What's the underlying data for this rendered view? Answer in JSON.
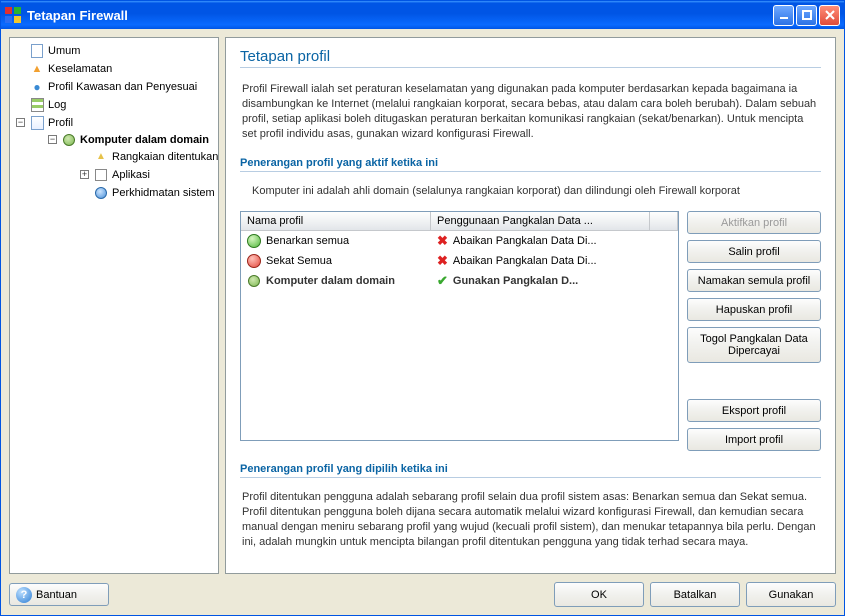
{
  "window": {
    "title": "Tetapan Firewall"
  },
  "sidebar": {
    "items": [
      {
        "label": "Umum"
      },
      {
        "label": "Keselamatan"
      },
      {
        "label": "Profil Kawasan dan Penyesuai"
      },
      {
        "label": "Log"
      },
      {
        "label": "Profil",
        "children": [
          {
            "label": "Komputer dalam domain",
            "selected": true,
            "children": [
              {
                "label": "Rangkaian ditentukan"
              },
              {
                "label": "Aplikasi",
                "expandable": true
              },
              {
                "label": "Perkhidmatan sistem"
              }
            ]
          }
        ]
      }
    ]
  },
  "main": {
    "title": "Tetapan profil",
    "intro": "Profil Firewall ialah set peraturan keselamatan yang digunakan pada komputer berdasarkan kepada bagaimana ia disambungkan ke Internet (melalui rangkaian korporat, secara bebas, atau dalam cara boleh berubah). Dalam sebuah profil, setiap aplikasi boleh ditugaskan peraturan berkaitan komunikasi rangkaian (sekat/benarkan). Untuk mencipta set profil individu asas, gunakan wizard konfigurasi Firewall.",
    "activeHeading": "Penerangan profil yang aktif ketika ini",
    "activeDesc": "Komputer ini adalah ahli domain (selalunya rangkaian korporat) dan dilindungi oleh  Firewall korporat",
    "selectedHeading": "Penerangan profil yang dipilih ketika ini",
    "selectedDesc": "Profil ditentukan pengguna adalah sebarang profil selain dua profil sistem asas: Benarkan semua dan Sekat semua. Profil ditentukan pengguna boleh dijana secara automatik melalui wizard konfigurasi Firewall, dan kemudian secara manual dengan meniru sebarang profil yang wujud (kecuali profil sistem), dan menukar tetapannya bila perlu. Dengan ini, adalah mungkin untuk mencipta bilangan profil ditentukan pengguna yang tidak terhad secara maya."
  },
  "table": {
    "headers": {
      "name": "Nama profil",
      "db": "Penggunaan Pangkalan Data ..."
    },
    "rows": [
      {
        "icon": "allow",
        "name": "Benarkan semua",
        "dbIcon": "no",
        "db": "Abaikan Pangkalan Data Di..."
      },
      {
        "icon": "block",
        "name": "Sekat Semua",
        "dbIcon": "no",
        "db": "Abaikan Pangkalan Data Di..."
      },
      {
        "icon": "user",
        "name": "Komputer dalam domain",
        "dbIcon": "yes",
        "db": "Gunakan Pangkalan D...",
        "selected": true
      }
    ]
  },
  "buttons": {
    "activate": "Aktifkan profil",
    "copy": "Salin profil",
    "rename": "Namakan semula profil",
    "delete": "Hapuskan profil",
    "toggle": "Togol Pangkalan Data Dipercayai",
    "export": "Eksport profil",
    "import": "Import profil"
  },
  "footer": {
    "help": "Bantuan",
    "ok": "OK",
    "cancel": "Batalkan",
    "apply": "Gunakan"
  }
}
